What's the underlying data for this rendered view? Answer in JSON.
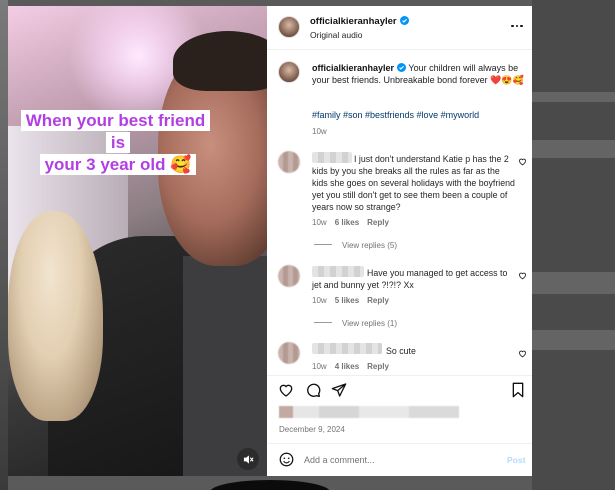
{
  "media": {
    "caption_line1": "When your best friend is",
    "caption_line2": "your 3 year old 🥰"
  },
  "header": {
    "username": "officialkieranhayler",
    "audio": "Original audio"
  },
  "post": {
    "username": "officialkieranhayler",
    "text": "Your children will always be your best friends. Unbreakable bond forever ❤️😍🥰",
    "hashtags": "#family #son #bestfriends #love #myworld",
    "age": "10w"
  },
  "comments": [
    {
      "text": "I just don't understand Katie p has the 2 kids by you she breaks all the rules as far as the kids she goes on several holidays with the boyfriend yet you still don't get to see them been a couple of years now so strange?",
      "age": "10w",
      "likes": "6 likes",
      "reply": "Reply",
      "view_replies": "View replies (5)"
    },
    {
      "text": "Have you managed to get access to jet and bunny yet ?!?!? Xx",
      "age": "10w",
      "likes": "5 likes",
      "reply": "Reply",
      "view_replies": "View replies (1)"
    },
    {
      "text": "So cute",
      "age": "10w",
      "likes": "4 likes",
      "reply": "Reply"
    }
  ],
  "footer": {
    "date": "December 9, 2024",
    "add_comment_placeholder": "Add a comment...",
    "post_label": "Post"
  },
  "colors": {
    "caption_text": "#b23fe3",
    "hashtag": "#00376b",
    "verified": "#0095f6",
    "post_button_disabled": "#b3dbff"
  },
  "icons": [
    "verified-badge-icon",
    "more-options-icon",
    "heart-icon",
    "comment-icon",
    "share-icon",
    "bookmark-icon",
    "emoji-icon",
    "mute-icon"
  ]
}
